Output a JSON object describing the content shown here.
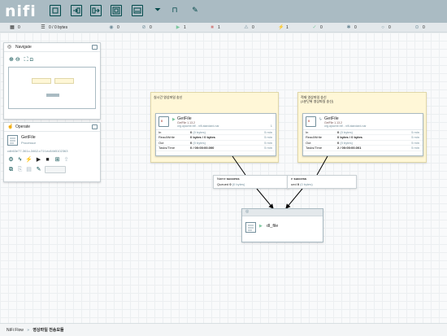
{
  "app": {
    "logo": "nifi",
    "toolbar": [
      {
        "icon": "processor-icon"
      },
      {
        "icon": "input-port-icon"
      },
      {
        "icon": "output-port-icon"
      },
      {
        "icon": "process-group-icon"
      },
      {
        "icon": "remote-process-group-icon"
      },
      {
        "icon": "funnel-icon"
      },
      {
        "icon": "template-icon"
      },
      {
        "icon": "label-icon"
      }
    ]
  },
  "status_bar": [
    {
      "icon": "cluster-icon",
      "value": "0"
    },
    {
      "icon": "queue-icon",
      "value": "0 / 0 bytes"
    },
    {
      "icon": "transmitting-icon",
      "value": "0"
    },
    {
      "icon": "not-transmitting-icon",
      "value": "0"
    },
    {
      "icon": "running-icon",
      "value": "1"
    },
    {
      "icon": "stopped-icon",
      "value": "1"
    },
    {
      "icon": "invalid-icon",
      "value": "0"
    },
    {
      "icon": "disabled-icon",
      "value": "1"
    },
    {
      "icon": "up-to-date-icon",
      "value": "0"
    },
    {
      "icon": "locally-modified-icon",
      "value": "0"
    },
    {
      "icon": "stale-icon",
      "value": "0"
    },
    {
      "icon": "sync-failure-icon",
      "value": "0"
    }
  ],
  "navigate": {
    "title": "Navigate"
  },
  "operate": {
    "title": "Operate",
    "component_name": "GetFile",
    "component_type": "Processor",
    "component_id": "cdb63e77-361c-3462-c71f-ec84b5102363"
  },
  "labels": [
    {
      "text": "실시간 영상파일 송신"
    },
    {
      "text": "적재 영상파일 송신\n(1분단위 영상파일 송신)"
    }
  ],
  "processors": [
    {
      "name": "GetFile",
      "type": "GetFile 1.13.2",
      "bundle": "org.apache.nifi - nifi-standard-nar",
      "badge": "0",
      "right": "1",
      "rows": [
        {
          "key": "In",
          "value": "0",
          "unit": "(0 bytes)",
          "time": "5 min"
        },
        {
          "key": "Read/Write",
          "value": "0 bytes / 0 bytes",
          "unit": "",
          "time": "5 min"
        },
        {
          "key": "Out",
          "value": "0",
          "unit": "(0 bytes)",
          "time": "5 min"
        },
        {
          "key": "Tasks/Time",
          "value": "0 / 00:00:00.000",
          "unit": "",
          "time": "5 min"
        }
      ]
    },
    {
      "name": "GetFile",
      "type": "GetFile 1.13.2",
      "bundle": "org.apache.nifi - nifi-standard-nar",
      "badge": "0",
      "right": "",
      "rows": [
        {
          "key": "In",
          "value": "0",
          "unit": "(0 bytes)",
          "time": "5 min"
        },
        {
          "key": "Read/Write",
          "value": "0 bytes / 0 bytes",
          "unit": "",
          "time": "5 min"
        },
        {
          "key": "Out",
          "value": "0",
          "unit": "(0 bytes)",
          "time": "5 min"
        },
        {
          "key": "Tasks/Time",
          "value": "2 / 00:00:00.001",
          "unit": "",
          "time": "5 min"
        }
      ]
    }
  ],
  "connections": [
    {
      "name_label": "Name",
      "name": "success",
      "queued_label": "Queued",
      "queued": "0",
      "queued_unit": "(0 bytes)"
    },
    {
      "name_label": "e",
      "name": "success",
      "queued_label": "ued",
      "queued": "0",
      "queued_unit": "(0 bytes)"
    }
  ],
  "funnel": {
    "name": "dl_file"
  },
  "breadcrumb": {
    "root": "NiFi Flow",
    "separator": "»",
    "current": "영상파일 전송모듈"
  }
}
